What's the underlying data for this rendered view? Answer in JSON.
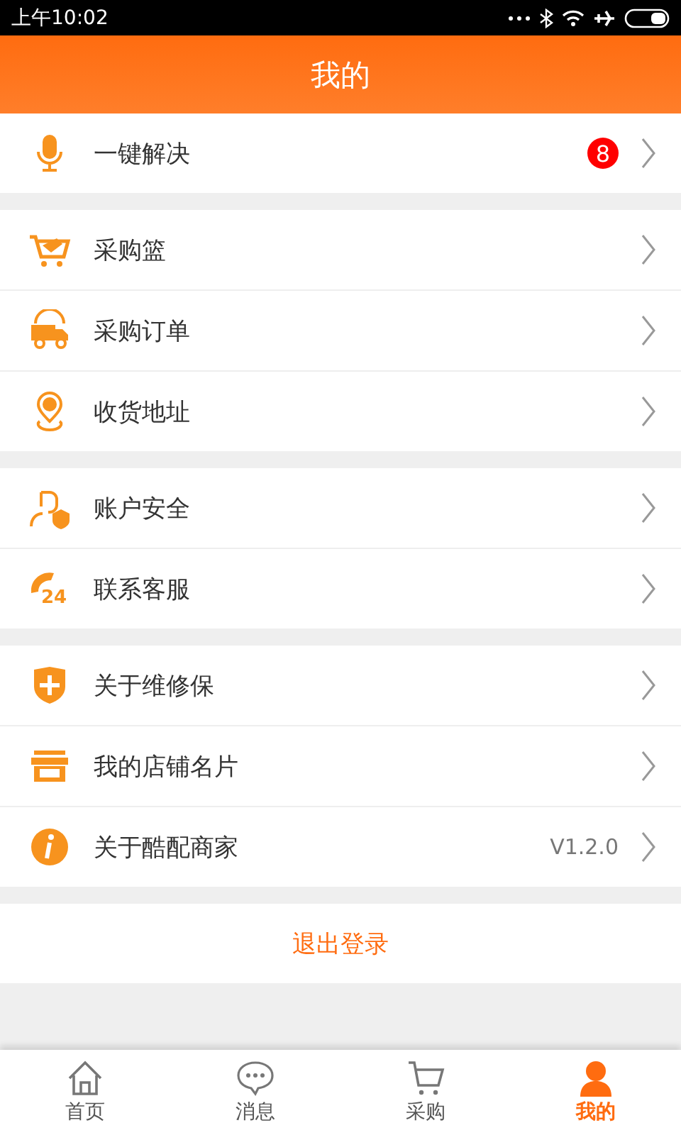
{
  "status_bar": {
    "time": "上午10:02"
  },
  "header": {
    "title": "我的"
  },
  "groups": [
    {
      "items": [
        {
          "kind": "mic",
          "label": "一键解决",
          "badge": "8"
        }
      ]
    },
    {
      "items": [
        {
          "kind": "basket",
          "label": "采购篮"
        },
        {
          "kind": "truck",
          "label": "采购订单"
        },
        {
          "kind": "pin",
          "label": "收货地址"
        }
      ]
    },
    {
      "items": [
        {
          "kind": "account",
          "label": "账户安全"
        },
        {
          "kind": "phone",
          "label": "联系客服",
          "icon_label": "24"
        }
      ]
    },
    {
      "items": [
        {
          "kind": "shield",
          "label": "关于维修保"
        },
        {
          "kind": "store",
          "label": "我的店铺名片"
        },
        {
          "kind": "info",
          "label": "关于酷配商家",
          "value": "V1.2.0"
        }
      ]
    }
  ],
  "logout": {
    "label": "退出登录"
  },
  "tab_bar": [
    {
      "kind": "home",
      "label": "首页",
      "selected": false
    },
    {
      "kind": "chat",
      "label": "消息",
      "selected": false
    },
    {
      "kind": "cart",
      "label": "采购",
      "selected": false
    },
    {
      "kind": "user",
      "label": "我的",
      "selected": true
    }
  ]
}
